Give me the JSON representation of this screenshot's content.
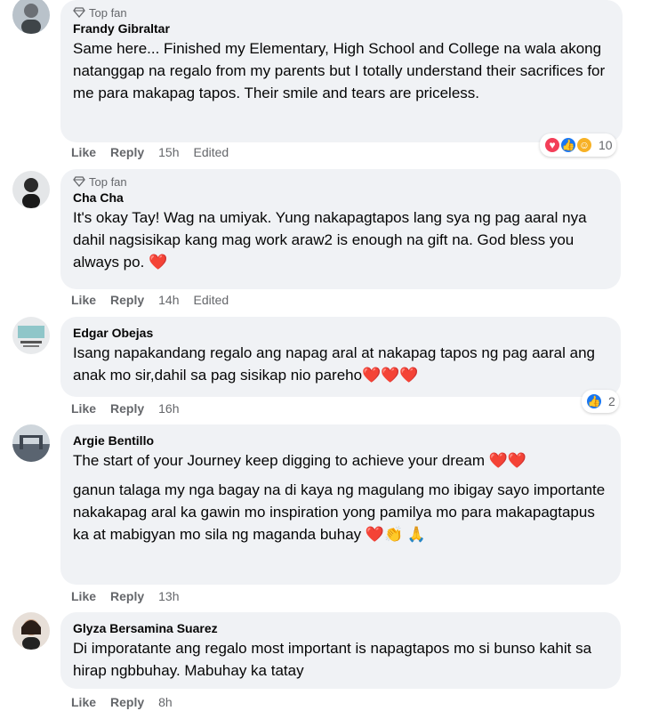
{
  "comments": [
    {
      "badge": "Top fan",
      "author": "Frandy Gibraltar",
      "text": "Same here... Finished my Elementary, High School and College na wala akong natanggap na regalo from my parents but I totally understand their sacrifices for me para makapag tapos. Their smile and tears are priceless.",
      "like": "Like",
      "reply": "Reply",
      "time": "15h",
      "edited": "Edited",
      "reaction_count": "10"
    },
    {
      "badge": "Top fan",
      "author": "Cha Cha",
      "text": "It's okay Tay! Wag na umiyak. Yung nakapagtapos lang sya ng pag aaral nya dahil nagsisikap kang mag work araw2 is enough na gift na. God bless you always po. ❤️",
      "like": "Like",
      "reply": "Reply",
      "time": "14h",
      "edited": "Edited"
    },
    {
      "author": "Edgar Obejas",
      "text": "Isang napakandang regalo ang napag aral at nakapag tapos ng pag aaral ang anak mo sir,dahil sa pag sisikap nio pareho❤️❤️❤️",
      "like": "Like",
      "reply": "Reply",
      "time": "16h",
      "reaction_count": "2"
    },
    {
      "author": "Argie Bentillo",
      "text": "The start of your Journey keep digging to achieve your dream ❤️❤️",
      "text2": "ganun talaga my nga bagay na di kaya ng magulang mo ibigay sayo importante nakakapag aral ka gawin mo inspiration yong pamilya mo para makapagtapus ka at mabigyan mo sila ng maganda buhay ❤️👏 🙏",
      "like": "Like",
      "reply": "Reply",
      "time": "13h"
    },
    {
      "author": "Glyza Bersamina Suarez",
      "text": "Di imporatante ang regalo most important is napagtapos mo si bunso kahit sa hirap ngbbuhay. Mabuhay ka tatay",
      "like": "Like",
      "reply": "Reply",
      "time": "8h"
    }
  ],
  "colors": {
    "bubble": "#f0f2f5",
    "meta": "#65676b",
    "like_blue": "#1877f2",
    "love_red": "#f33e58",
    "care_yellow": "#f7b125"
  },
  "icons": {
    "badge": "diamond-icon",
    "like": "thumbs-up-icon",
    "love": "heart-icon",
    "care": "care-icon"
  }
}
